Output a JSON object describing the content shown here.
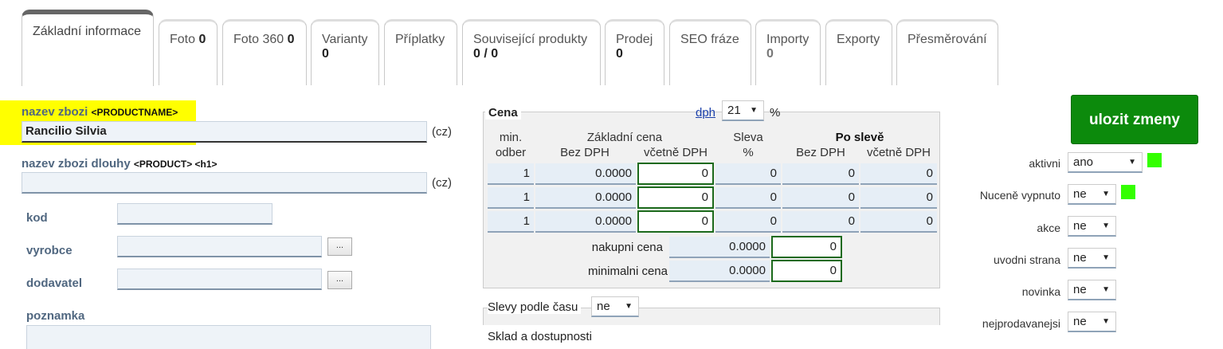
{
  "tabs": [
    {
      "label": "Základní informace",
      "count": ""
    },
    {
      "label": "Foto",
      "count": "0"
    },
    {
      "label": "Foto 360",
      "count": "0"
    },
    {
      "label": "Varianty",
      "count": "0"
    },
    {
      "label": "Příplatky",
      "count": ""
    },
    {
      "label": "Související produkty",
      "count": "0 / 0"
    },
    {
      "label": "Prodej",
      "count": "0"
    },
    {
      "label": "SEO fráze",
      "count": ""
    },
    {
      "label": "Importy",
      "count": "0"
    },
    {
      "label": "Exporty",
      "count": ""
    },
    {
      "label": "Přesměrování",
      "count": ""
    }
  ],
  "form": {
    "name_label": "nazev zbozi",
    "name_tag": "<PRODUCTNAME>",
    "name_value": "Rancilio Silvia",
    "lang": "(cz)",
    "long_name_label": "nazev zbozi dlouhy",
    "long_name_tag": "<PRODUCT> <h1>",
    "long_name_value": "",
    "kod_label": "kod",
    "vyrobce_label": "vyrobce",
    "dodavatel_label": "dodavatel",
    "poznamka_label": "poznamka",
    "dots_label": "..."
  },
  "price": {
    "title": "Cena",
    "dph_link": "dph",
    "dph_value": "21",
    "percent": "%",
    "hdr_min": "min.",
    "hdr_odber": "odber",
    "hdr_base": "Základní cena",
    "hdr_bez": "Bez DPH",
    "hdr_vcetne": "včetně DPH",
    "hdr_sleva": "Sleva",
    "hdr_sleva_pct": "%",
    "hdr_po_sleve": "Po slevě",
    "hdr_bez2": "Bez DPH",
    "hdr_vcetne2": "včetně DPH",
    "rows": [
      {
        "min": "1",
        "bez": "0.0000",
        "vcetne": "0",
        "sleva": "0",
        "po_bez": "0",
        "po_vcetne": "0"
      },
      {
        "min": "1",
        "bez": "0.0000",
        "vcetne": "0",
        "sleva": "0",
        "po_bez": "0",
        "po_vcetne": "0"
      },
      {
        "min": "1",
        "bez": "0.0000",
        "vcetne": "0",
        "sleva": "0",
        "po_bez": "0",
        "po_vcetne": "0"
      }
    ],
    "nakupni_label": "nakupni cena",
    "nakupni_bez": "0.0000",
    "nakupni_vcetne": "0",
    "minimalni_label": "minimalni cena",
    "minimalni_bez": "0.0000",
    "minimalni_vcetne": "0"
  },
  "slevy": {
    "label": "Slevy podle času",
    "value": "ne"
  },
  "sklad": {
    "label": "Sklad a dostupnosti"
  },
  "save_label": "ulozit zmeny",
  "flags": [
    {
      "label": "aktivni",
      "value": "ano"
    },
    {
      "label": "Nuceně vypnuto",
      "value": "ne"
    },
    {
      "label": "akce",
      "value": "ne"
    },
    {
      "label": "uvodni strana",
      "value": "ne"
    },
    {
      "label": "novinka",
      "value": "ne"
    },
    {
      "label": "nejprodavanejsi",
      "value": "ne"
    }
  ],
  "colors": {
    "save": "#0c8a0c",
    "indicator": "#33ff00",
    "highlight": "#ffff00"
  }
}
